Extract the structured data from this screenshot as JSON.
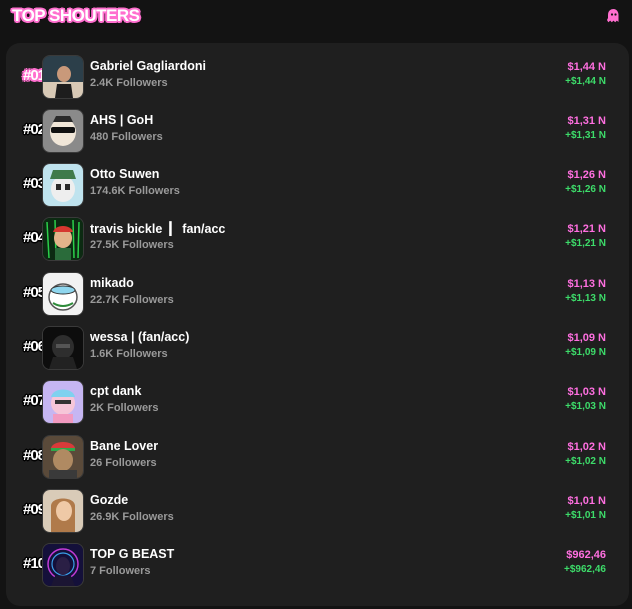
{
  "header": {
    "title": "TOP SHOUTERS",
    "icon": "ghost-icon",
    "accent_color": "#ff6fcf"
  },
  "colors": {
    "amount": "#ff6fe0",
    "delta": "#3ddc6a",
    "followers": "#9a9a9a"
  },
  "leaderboard": {
    "rows": [
      {
        "rank": "#01",
        "name": "Gabriel Gagliardoni",
        "followers": "2.4K Followers",
        "amount": "$1,44 N",
        "delta": "+$1,44 N"
      },
      {
        "rank": "#02",
        "name": "AHS | GoH",
        "followers": "480 Followers",
        "amount": "$1,31 N",
        "delta": "+$1,31 N"
      },
      {
        "rank": "#03",
        "name": "Otto Suwen",
        "followers": "174.6K Followers",
        "amount": "$1,26 N",
        "delta": "+$1,26 N"
      },
      {
        "rank": "#04",
        "name": "travis bickle  ▎ fan/acc",
        "followers": "27.5K Followers",
        "amount": "$1,21 N",
        "delta": "+$1,21 N"
      },
      {
        "rank": "#05",
        "name": "mikado",
        "followers": "22.7K Followers",
        "amount": "$1,13 N",
        "delta": "+$1,13 N"
      },
      {
        "rank": "#06",
        "name": "wessa | (fan/acc)",
        "followers": "1.6K Followers",
        "amount": "$1,09 N",
        "delta": "+$1,09 N"
      },
      {
        "rank": "#07",
        "name": "cpt dank",
        "followers": "2K Followers",
        "amount": "$1,03 N",
        "delta": "+$1,03 N"
      },
      {
        "rank": "#08",
        "name": "Bane Lover",
        "followers": "26 Followers",
        "amount": "$1,02 N",
        "delta": "+$1,02 N"
      },
      {
        "rank": "#09",
        "name": "Gozde",
        "followers": "26.9K Followers",
        "amount": "$1,01 N",
        "delta": "+$1,01 N"
      },
      {
        "rank": "#10",
        "name": "TOP G BEAST",
        "followers": "7 Followers",
        "amount": "$962,46",
        "delta": "+$962,46"
      }
    ]
  }
}
